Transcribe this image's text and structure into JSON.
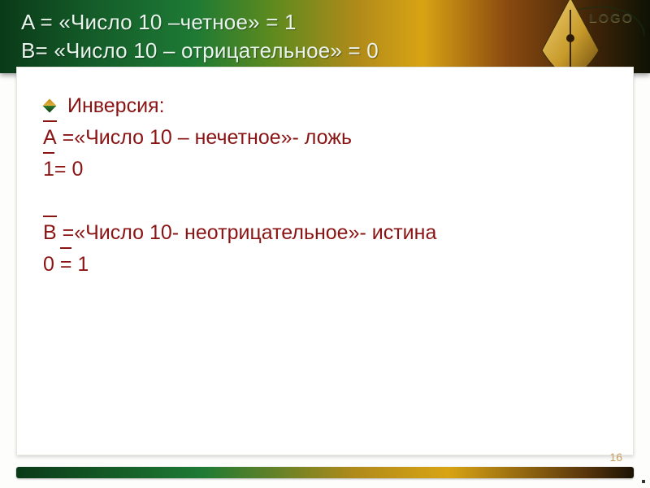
{
  "logo_text": "LOGO",
  "header": {
    "line1": "A = «Число 10 –четное» = 1",
    "line2": "B= «Число 10 – отрицательное» = 0"
  },
  "content": {
    "bullet": "Инверсия:",
    "line_A_var": "A",
    "line_A_rest": " =«Число 10 – нечетное»- ложь",
    "line_eq1_left": "1",
    "line_eq1_right": " 0",
    "line_B_var": "B",
    "line_B_rest": " =«Число 10- неотрицательное»- истина",
    "line_eq2_left": "0 ",
    "line_eq2_mid": "=",
    "line_eq2_right": " 1"
  },
  "page_number": "16"
}
